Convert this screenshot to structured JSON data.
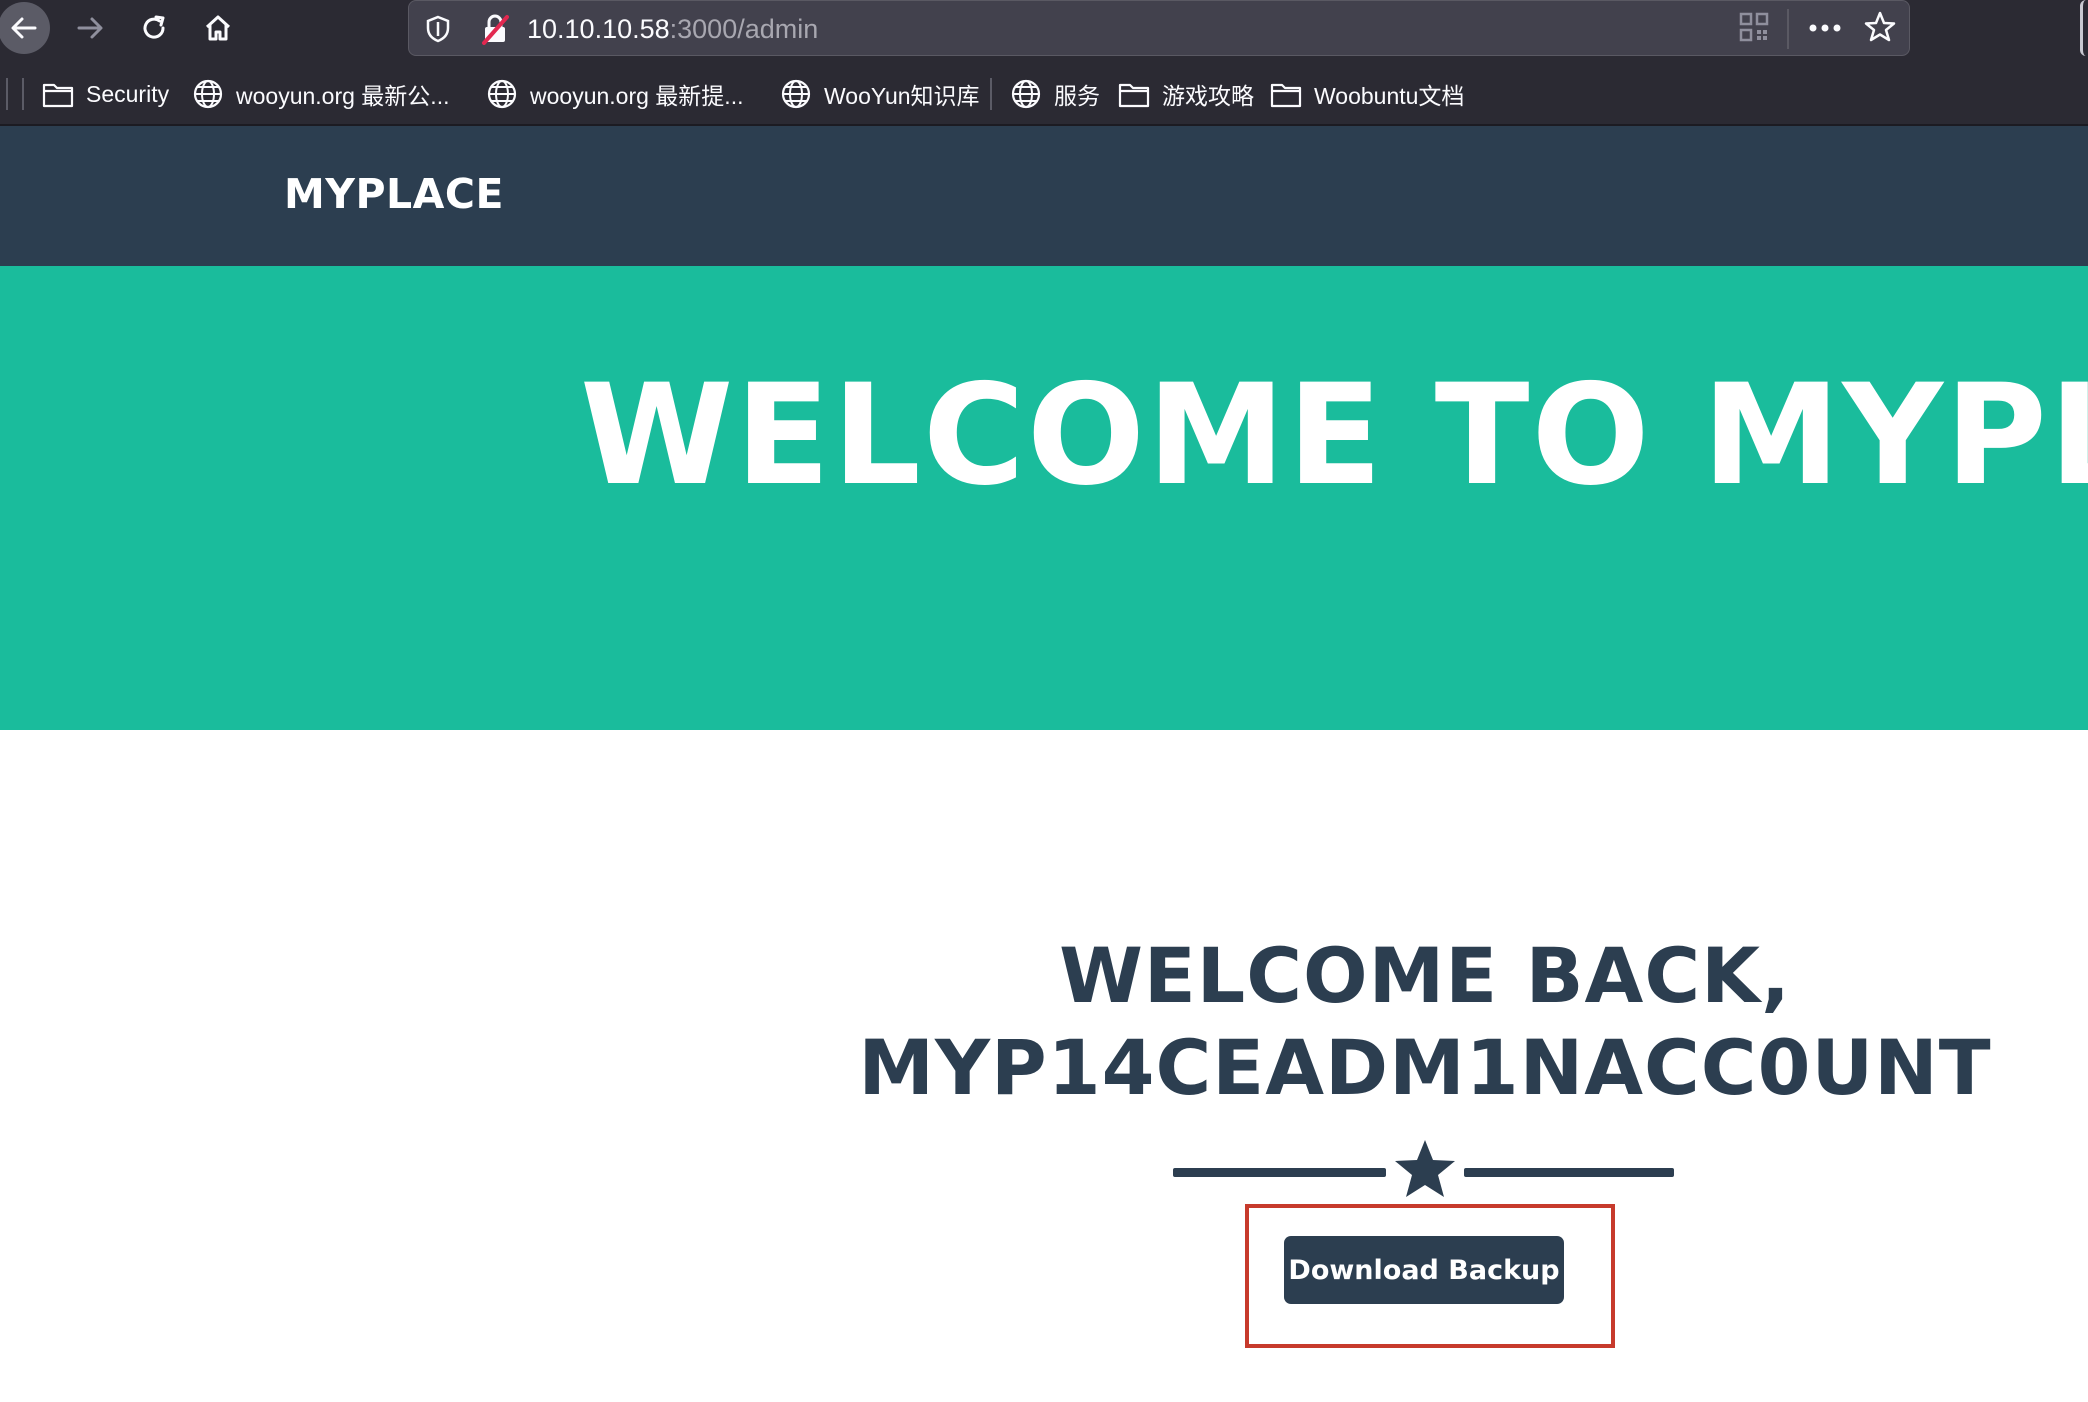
{
  "browser": {
    "url_host": "10.10.10.58",
    "url_rest": ":3000/admin",
    "icons": [
      "back-arrow-icon",
      "forward-arrow-icon",
      "reload-icon",
      "home-icon",
      "shield-icon",
      "insecure-lock-icon",
      "qr-code-icon",
      "more-icon",
      "star-icon"
    ],
    "bookmarks": [
      {
        "label": "Security",
        "icon": "folder-icon"
      },
      {
        "label": "wooyun.org 最新公...",
        "icon": "globe-icon"
      },
      {
        "label": "wooyun.org 最新提...",
        "icon": "globe-icon"
      },
      {
        "label": "WooYun知识库",
        "icon": "globe-icon"
      },
      {
        "label": "服务",
        "icon": "globe-icon"
      },
      {
        "label": "游戏攻略",
        "icon": "folder-icon"
      },
      {
        "label": "Woobuntu文档",
        "icon": "folder-icon"
      }
    ]
  },
  "site": {
    "brand": "MYPLACE",
    "masthead_heading": "WELCOME TO MYPLA",
    "welcome_line1": "WELCOME BACK,",
    "welcome_line2": "MYP14CEADM1NACC0UNT",
    "download_label": "Download Backup"
  },
  "colors": {
    "navbar": "#2c3e50",
    "masthead": "#1abc9c",
    "heading_text": "#2c3e50",
    "highlight_box": "#c73a2c",
    "browser_chrome": "#2b2a33"
  }
}
